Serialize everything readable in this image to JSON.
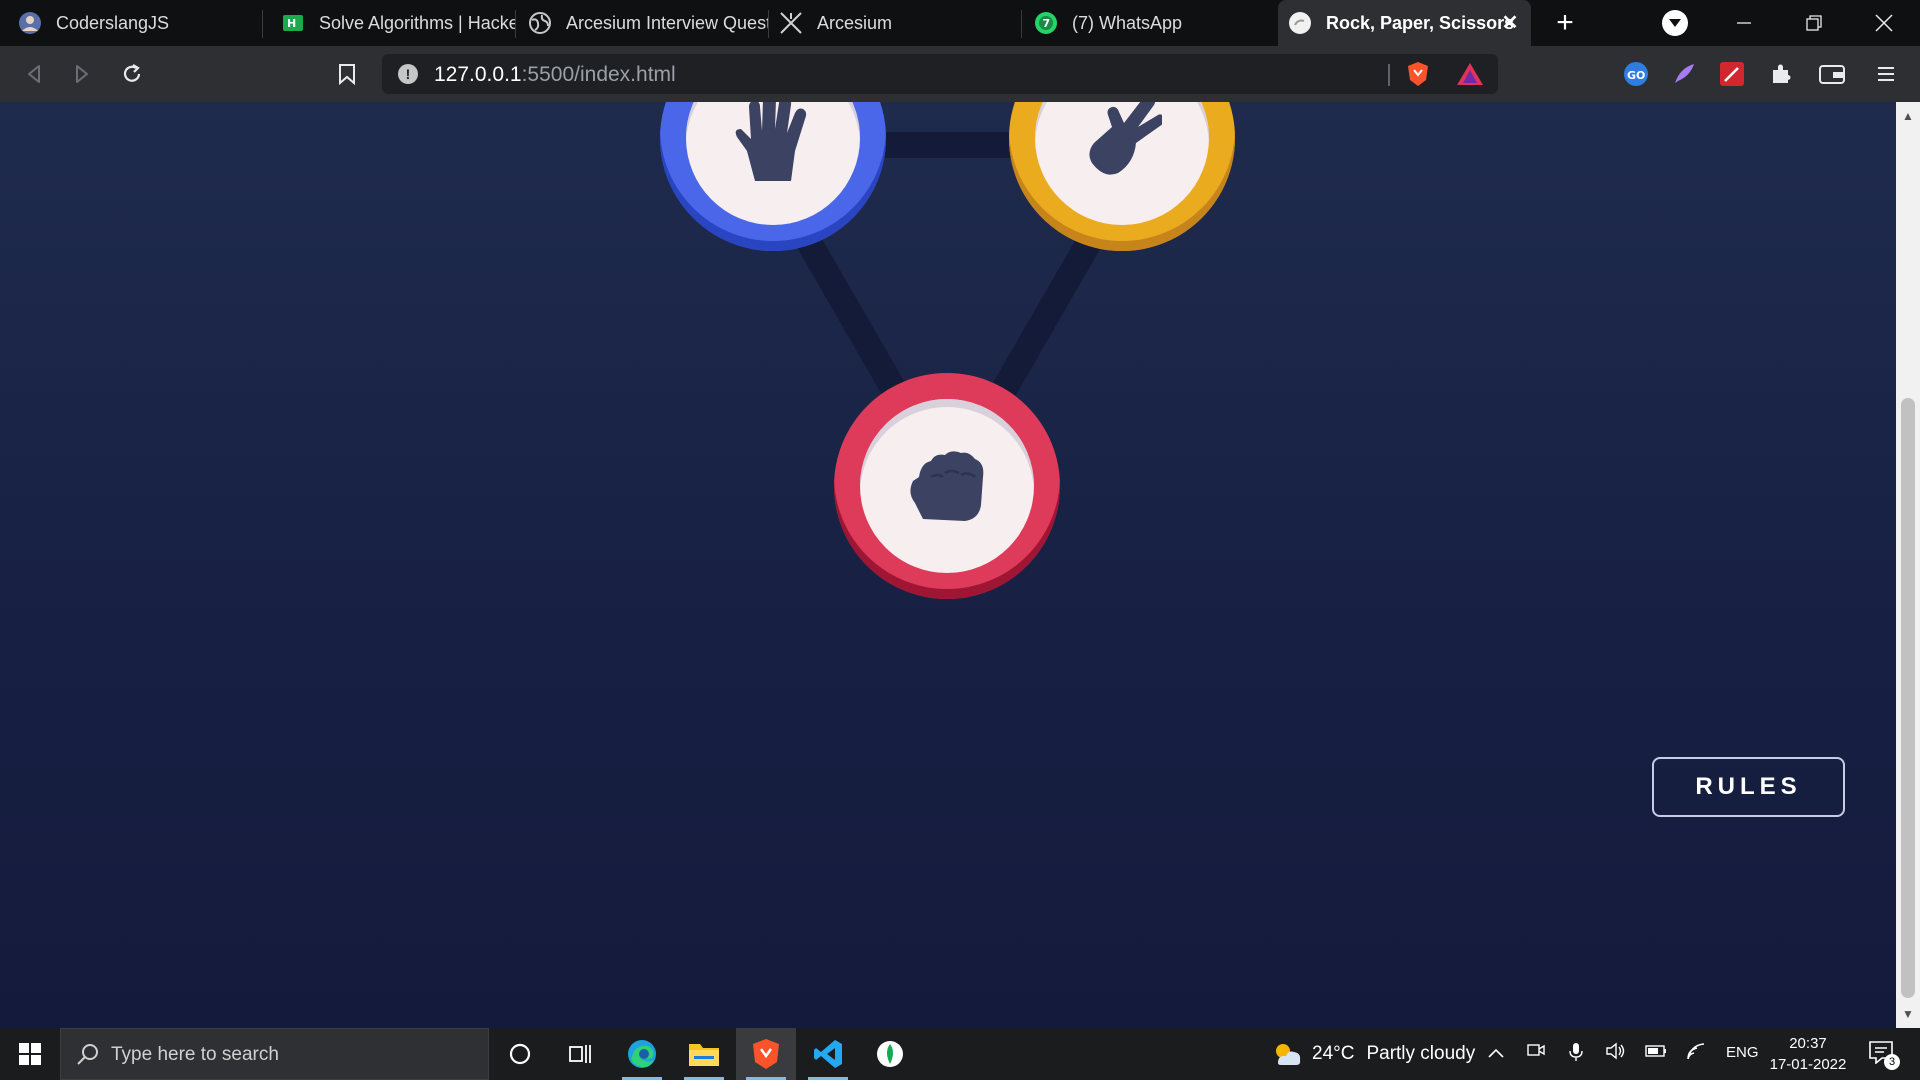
{
  "browser": {
    "tabs": [
      {
        "label": "CoderslangJS",
        "icon": "avatar-icon",
        "active": false
      },
      {
        "label": "Solve Algorithms | HackerR",
        "icon": "hackerrank-icon",
        "active": false
      },
      {
        "label": "Arcesium Interview Questio",
        "icon": "globe-icon",
        "active": false
      },
      {
        "label": "Arcesium",
        "icon": "arcesium-logo-icon",
        "active": false
      },
      {
        "label": "(7) WhatsApp",
        "icon": "whatsapp-icon",
        "active": false
      },
      {
        "label": "Rock, Paper, Scissors",
        "icon": "default-page-icon",
        "active": true
      }
    ],
    "close_glyph": "✕",
    "new_tab_glyph": "+",
    "address": {
      "host": "127.0.0.1",
      "path": ":5500/index.html"
    },
    "colors": {
      "tabstrip": "#0f1012",
      "toolbar": "#2d2f33",
      "omnibox": "#1f2023"
    }
  },
  "game": {
    "choices": [
      {
        "id": "paper",
        "icon": "hand-paper-icon",
        "color": "#4a67ea"
      },
      {
        "id": "scissors",
        "icon": "hand-scissors-icon",
        "color": "#ebab1f"
      },
      {
        "id": "rock",
        "icon": "hand-rock-icon",
        "color": "#de3a5a"
      }
    ],
    "rules_label": "RULES",
    "background": [
      "#1f2b4d",
      "#141a3c"
    ]
  },
  "taskbar": {
    "search_placeholder": "Type here to search",
    "weather": {
      "temp": "24°C",
      "condition": "Partly cloudy"
    },
    "language": "ENG",
    "time": "20:37",
    "date": "17-01-2022",
    "notification_count": "3",
    "apps": [
      "cortana-icon",
      "task-view-icon",
      "edge-icon",
      "file-explorer-icon",
      "brave-icon",
      "vscode-icon",
      "mongodb-compass-icon"
    ]
  }
}
